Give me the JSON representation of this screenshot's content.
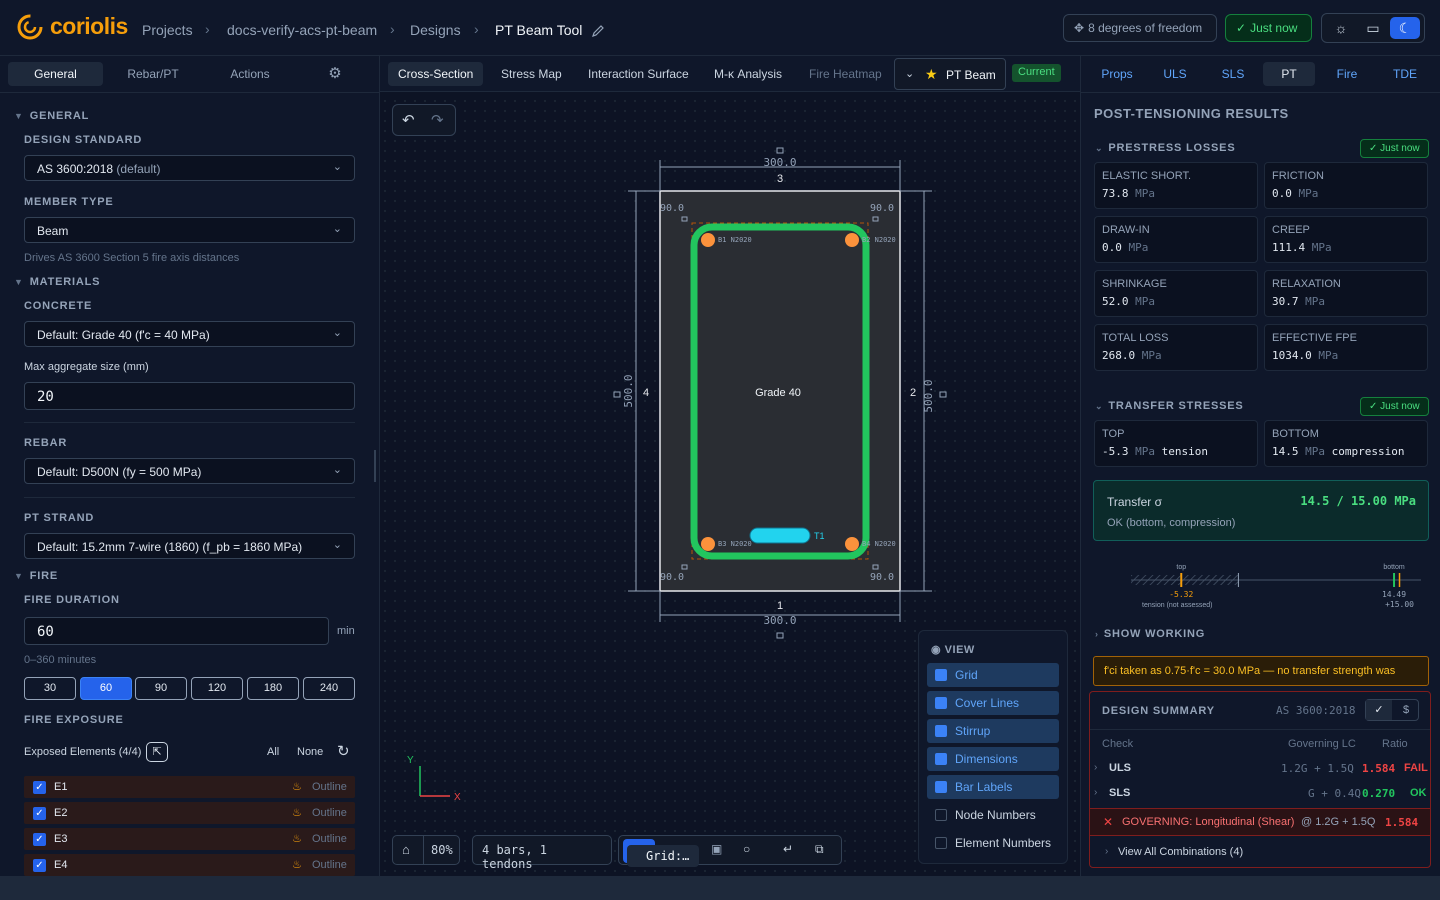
{
  "app": {
    "name": "coriolis"
  },
  "breadcrumb": {
    "projects": "Projects",
    "project": "docs-verify-acs-pt-beam",
    "designs": "Designs",
    "design": "PT Beam Tool",
    "sep": "›"
  },
  "header": {
    "dof": "8 degrees of freedom",
    "saved": "Just now"
  },
  "left": {
    "tabs": [
      "General",
      "Rebar/PT",
      "Actions"
    ],
    "general_head": "GENERAL",
    "design_standard": {
      "label": "DESIGN STANDARD",
      "value": "AS 3600:2018",
      "suffix": "(default)"
    },
    "member_type": {
      "label": "MEMBER TYPE",
      "value": "Beam",
      "hint": "Drives AS 3600 Section 5 fire axis distances"
    },
    "materials_head": "MATERIALS",
    "concrete": {
      "label": "CONCRETE",
      "value": "Default: Grade 40 (f'c = 40 MPa)"
    },
    "aggregate": {
      "label": "Max aggregate size (mm)",
      "value": "20"
    },
    "rebar": {
      "label": "REBAR",
      "value": "Default: D500N (fy = 500 MPa)"
    },
    "strand": {
      "label": "PT STRAND",
      "value": "Default: 15.2mm 7-wire (1860) (f_pb = 1860 MPa)"
    },
    "fire_head": "FIRE",
    "fire_duration": {
      "label": "FIRE DURATION",
      "value": "60",
      "unit": "min",
      "hint": "0–360 minutes",
      "presets": [
        "30",
        "60",
        "90",
        "120",
        "180",
        "240"
      ],
      "selected": "60"
    },
    "fire_exposure": {
      "label": "FIRE EXPOSURE",
      "exposed": "Exposed Elements (4/4)",
      "all": "All",
      "none": "None",
      "elements": [
        {
          "name": "E1",
          "mode": "Outline"
        },
        {
          "name": "E2",
          "mode": "Outline"
        },
        {
          "name": "E3",
          "mode": "Outline"
        },
        {
          "name": "E4",
          "mode": "Outline"
        }
      ]
    }
  },
  "center": {
    "tabs": [
      "Cross-Section",
      "Stress Map",
      "Interaction Surface",
      "M-κ Analysis",
      "Fire Heatmap"
    ],
    "design_tag": "PT Beam",
    "current": "Current",
    "section": {
      "width": 300.0,
      "depth": 500.0,
      "cover": 90.0,
      "width_label": "300.0",
      "depth_label": "500.0",
      "cover_label": "90.0",
      "edge_labels": [
        "1",
        "2",
        "3",
        "4"
      ],
      "material": "Grade 40",
      "bars": [
        {
          "id": "B1",
          "size": "N20",
          "label": "B1 N2020"
        },
        {
          "id": "B2",
          "size": "N20",
          "label": "B2 N2020"
        },
        {
          "id": "B3",
          "size": "N20",
          "label": "B3 N2020"
        },
        {
          "id": "B4",
          "size": "N20",
          "label": "B4 N2020"
        }
      ],
      "tendon": "T1"
    },
    "axes": {
      "x": "X",
      "y": "Y"
    },
    "view": {
      "title": "VIEW",
      "options": [
        {
          "label": "Grid",
          "on": true
        },
        {
          "label": "Cover Lines",
          "on": true
        },
        {
          "label": "Stirrup",
          "on": true
        },
        {
          "label": "Dimensions",
          "on": true
        },
        {
          "label": "Bar Labels",
          "on": true
        },
        {
          "label": "Node Numbers",
          "on": false
        },
        {
          "label": "Element Numbers",
          "on": false
        }
      ]
    },
    "zoom": "80%",
    "summary": "4 bars, 1 tendons",
    "grid": "Grid:…"
  },
  "right": {
    "tabs": [
      "Props",
      "ULS",
      "SLS",
      "PT",
      "Fire",
      "TDE"
    ],
    "title": "POST-TENSIONING RESULTS",
    "losses_head": "PRESTRESS LOSSES",
    "losses_status": "Just now",
    "losses": [
      {
        "label": "ELASTIC SHORT.",
        "value": "73.8",
        "unit": "MPa"
      },
      {
        "label": "FRICTION",
        "value": "0.0",
        "unit": "MPa"
      },
      {
        "label": "DRAW-IN",
        "value": "0.0",
        "unit": "MPa"
      },
      {
        "label": "CREEP",
        "value": "111.4",
        "unit": "MPa"
      },
      {
        "label": "SHRINKAGE",
        "value": "52.0",
        "unit": "MPa"
      },
      {
        "label": "RELAXATION",
        "value": "30.7",
        "unit": "MPa"
      },
      {
        "label": "TOTAL LOSS",
        "value": "268.0",
        "unit": "MPa"
      },
      {
        "label": "EFFECTIVE FPE",
        "value": "1034.0",
        "unit": "MPa"
      }
    ],
    "transfer_head": "TRANSFER STRESSES",
    "transfer_status": "Just now",
    "transfer": [
      {
        "label": "TOP",
        "value": "-5.3",
        "unit": "MPa",
        "note": "tension"
      },
      {
        "label": "BOTTOM",
        "value": "14.5",
        "unit": "MPa",
        "note": "compression"
      }
    ],
    "transfer_sigma": {
      "label": "Transfer σ",
      "value": "14.5 / 15.00 MPa",
      "status": "OK (bottom, compression)"
    },
    "gauge": {
      "top_label": "top",
      "top_value": "-5.32",
      "top_note": "tension (not assessed)",
      "bottom_label": "bottom",
      "bottom_value": "14.49",
      "limit": "+15.00",
      "top_num": -5.32,
      "bottom_num": 14.49,
      "limit_num": 15.0
    },
    "show_working": "SHOW WORKING",
    "warning": "f'ci taken as 0.75·f'c = 30.0 MPa — no transfer strength was"
  },
  "summary": {
    "title": "DESIGN SUMMARY",
    "standard": "AS 3600:2018",
    "cols": [
      "Check",
      "Governing LC",
      "Ratio"
    ],
    "rows": [
      {
        "check": "ULS",
        "lc": "1.2G + 1.5Q",
        "ratio": "1.584",
        "status": "FAIL"
      },
      {
        "check": "SLS",
        "lc": "G + 0.4Q",
        "ratio": "0.270",
        "status": "OK"
      }
    ],
    "governing": "GOVERNING: Longitudinal (Shear)",
    "governing_lc": "@ 1.2G + 1.5Q",
    "governing_ratio": "1.584",
    "all": "View All Combinations (4)"
  },
  "colors": {
    "accent": "#2563eb",
    "fail": "#ef4444",
    "ok": "#22c55e",
    "stirrup": "#22c55e",
    "bar": "#fb923c",
    "tendon": "#22d3ee",
    "logo": "#f59e0b"
  }
}
